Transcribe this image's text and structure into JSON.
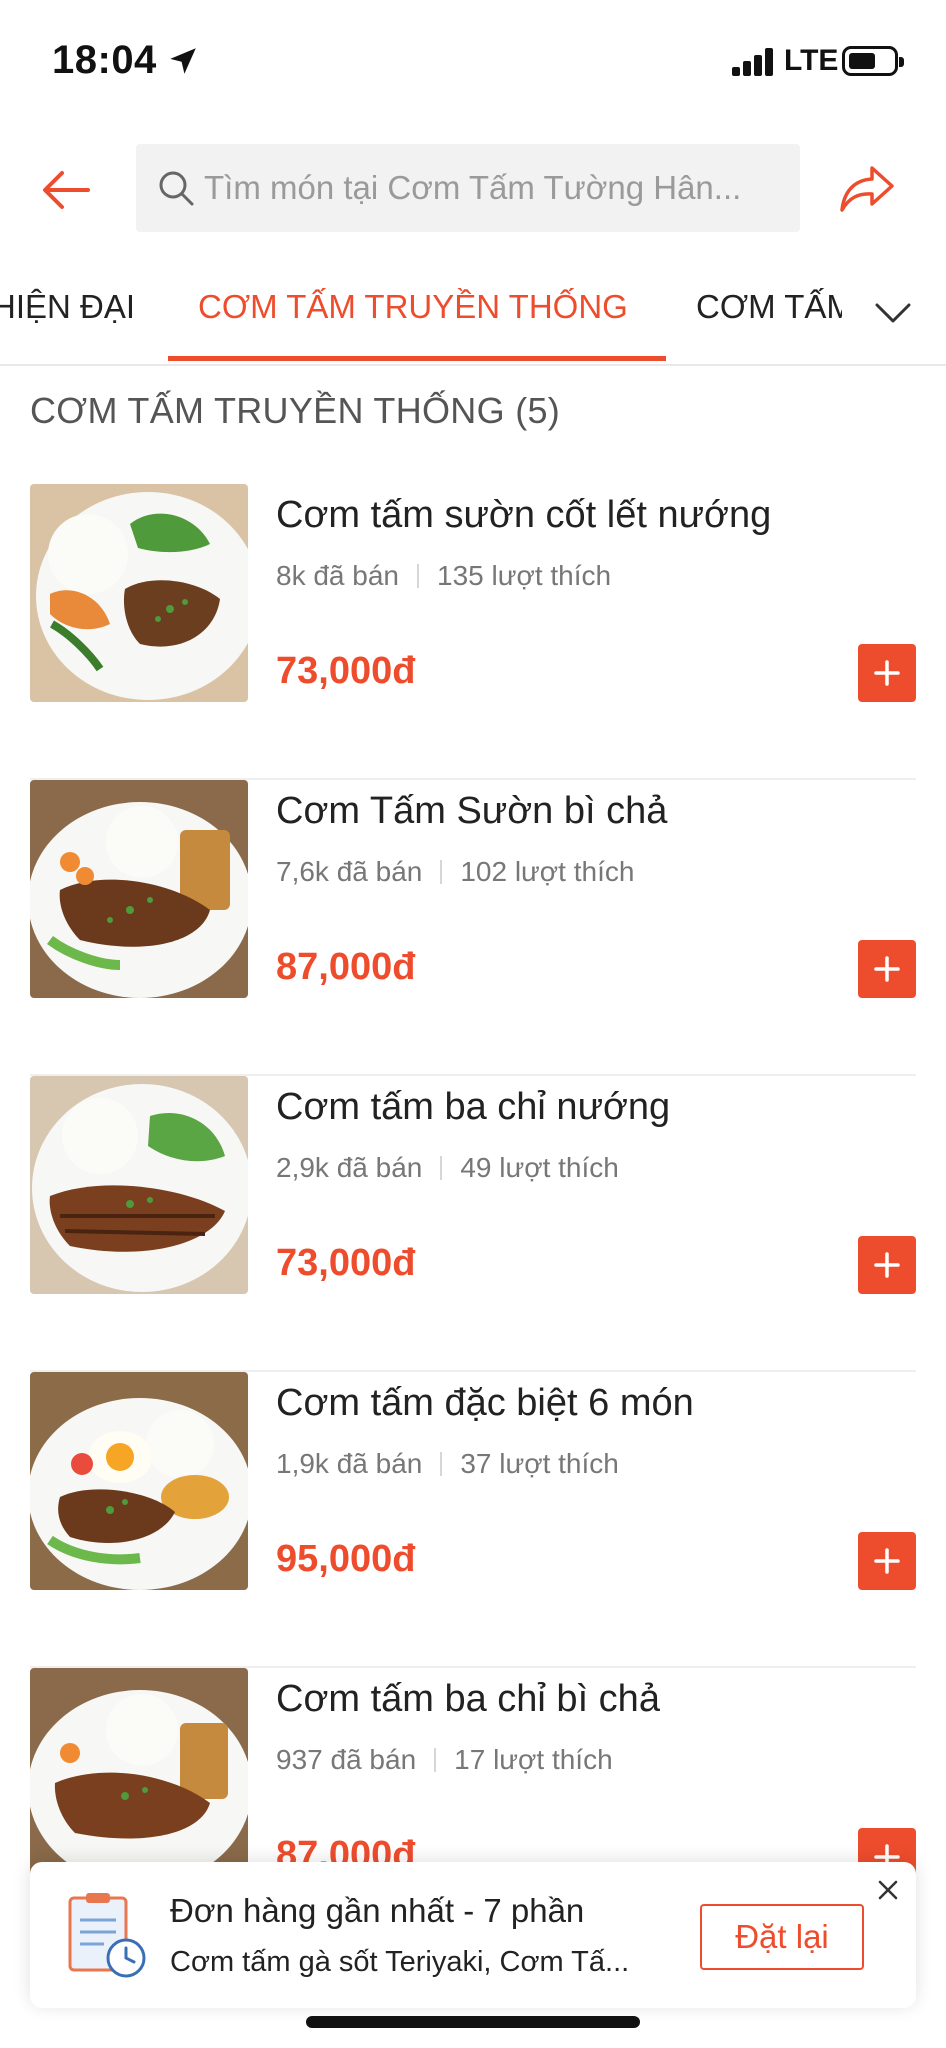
{
  "status_bar": {
    "time": "18:04",
    "network": "LTE"
  },
  "header": {
    "search_placeholder": "Tìm món tại Cơm Tấm Tường Hân...",
    "back_icon": "back-arrow-icon",
    "share_icon": "share-icon"
  },
  "tabs": [
    {
      "label": "HIỆN ĐẠI",
      "active": false
    },
    {
      "label": "CƠM TẤM TRUYỀN THỐNG",
      "active": true
    },
    {
      "label": "CƠM TẤM",
      "active": false
    }
  ],
  "section": {
    "title": "CƠM TẤM TRUYỀN THỐNG (5)"
  },
  "items": [
    {
      "name": "Cơm tấm sườn cốt lết nướng",
      "sold": "8k đã bán",
      "likes": "135 lượt thích",
      "price": "73,000đ"
    },
    {
      "name": "Cơm Tấm Sườn bì chả",
      "sold": "7,6k đã bán",
      "likes": "102 lượt thích",
      "price": "87,000đ"
    },
    {
      "name": "Cơm tấm ba chỉ nướng",
      "sold": "2,9k đã bán",
      "likes": "49 lượt thích",
      "price": "73,000đ"
    },
    {
      "name": "Cơm tấm đặc biệt 6 món",
      "sold": "1,9k đã bán",
      "likes": "37 lượt thích",
      "price": "95,000đ"
    },
    {
      "name": "Cơm tấm ba chỉ bì chả",
      "sold": "937 đã bán",
      "likes": "17 lượt thích",
      "price": "87,000đ"
    }
  ],
  "order_card": {
    "title": "Đơn hàng gần nhất - 7 phần",
    "subtitle": "Cơm tấm gà sốt Teriyaki, Cơm Tấ...",
    "reorder_label": "Đặt lại"
  },
  "colors": {
    "accent": "#ee4d2d",
    "text": "#222222",
    "muted": "#777777"
  }
}
